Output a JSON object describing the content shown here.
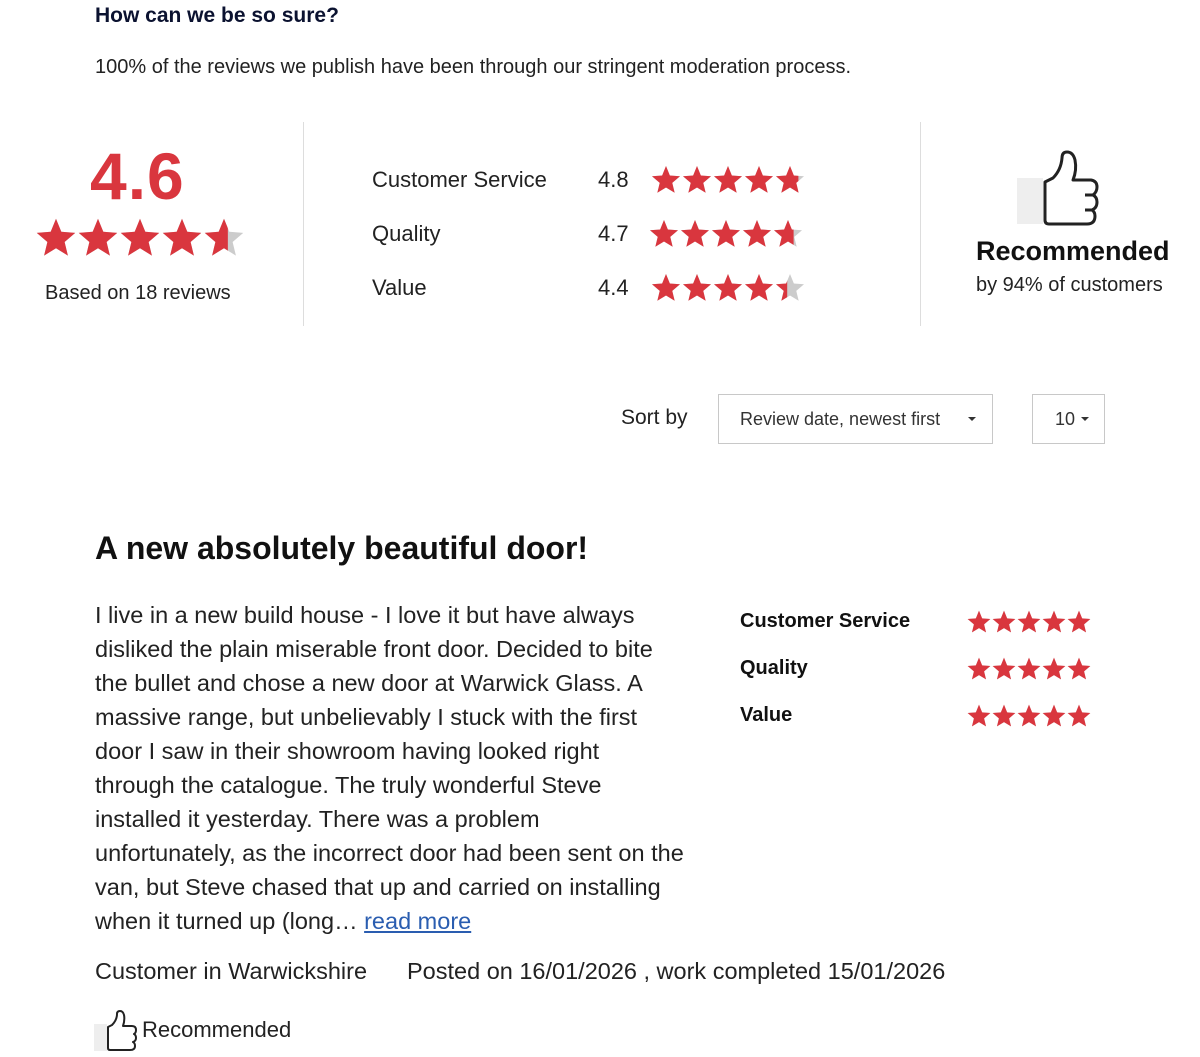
{
  "header": {
    "title": "How can we be so sure?",
    "intro": "100% of the reviews we publish have been through our stringent moderation process."
  },
  "summary": {
    "score": "4.6",
    "score_value": 4.6,
    "based_on": "Based on 18 reviews"
  },
  "sub_ratings": [
    {
      "label": "Customer Service",
      "score": "4.8",
      "value": 4.8
    },
    {
      "label": "Quality",
      "score": "4.7",
      "value": 4.7
    },
    {
      "label": "Value",
      "score": "4.4",
      "value": 4.4
    }
  ],
  "recommended": {
    "icon": "thumbs-up-icon",
    "title": "Recommended",
    "subtitle": "by 94% of customers"
  },
  "sort": {
    "label": "Sort by",
    "selected": "Review date, newest first",
    "per_page": "10"
  },
  "review": {
    "title": "A new absolutely beautiful door!",
    "body": "I live in a new build house - I love it but have always disliked the plain miserable front door. Decided to bite the bullet and chose a new door at Warwick Glass. A massive range, but unbelievably I stuck with the first door I saw in their showroom having looked right through the catalogue. The truly wonderful Steve installed it yesterday. There was a problem unfortunately, as the incorrect door had been sent on the van, but Steve chased that up and carried on installing when it turned up (long…",
    "read_more": "read more",
    "ratings": [
      {
        "label": "Customer Service",
        "value": 5
      },
      {
        "label": "Quality",
        "value": 5
      },
      {
        "label": "Value",
        "value": 5
      }
    ],
    "author": "Customer in Warwickshire",
    "posted": "Posted on 16/01/2026 , work completed 15/01/2026",
    "recommended_label": "Recommended"
  },
  "colors": {
    "star_filled": "#d9363e",
    "star_empty": "#cccccc",
    "link": "#2a5db0"
  }
}
